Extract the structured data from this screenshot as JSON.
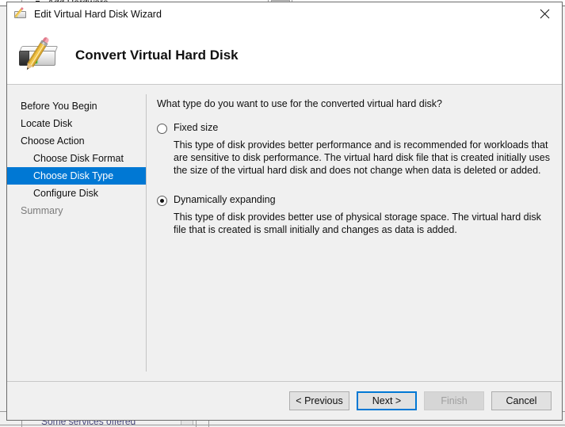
{
  "background": {
    "top_window_text": "Add Hardware",
    "bottom_window_text": "Some services offered"
  },
  "dialog": {
    "titlebar": {
      "title": "Edit Virtual Hard Disk Wizard",
      "icon": "disk-pencil-icon",
      "close_label": "Close"
    },
    "header": {
      "heading": "Convert Virtual Hard Disk",
      "icon": "virtual-hard-disk-edit-icon"
    },
    "nav": {
      "items": [
        {
          "label": "Before You Begin",
          "indent": false,
          "selected": false,
          "dim": false
        },
        {
          "label": "Locate Disk",
          "indent": false,
          "selected": false,
          "dim": false
        },
        {
          "label": "Choose Action",
          "indent": false,
          "selected": false,
          "dim": false
        },
        {
          "label": "Choose Disk Format",
          "indent": true,
          "selected": false,
          "dim": false
        },
        {
          "label": "Choose Disk Type",
          "indent": true,
          "selected": true,
          "dim": false
        },
        {
          "label": "Configure Disk",
          "indent": true,
          "selected": false,
          "dim": false
        },
        {
          "label": "Summary",
          "indent": false,
          "selected": false,
          "dim": true
        }
      ],
      "selected_color": "#0078d4"
    },
    "content": {
      "question": "What type do you want to use for the converted virtual hard disk?",
      "options": [
        {
          "label": "Fixed size",
          "checked": false,
          "description": "This type of disk provides better performance and is recommended for workloads that are sensitive to disk performance. The virtual hard disk file that is created initially uses the size of the virtual hard disk and does not change when data is deleted or added."
        },
        {
          "label": "Dynamically expanding",
          "checked": true,
          "description": "This type of disk provides better use of physical storage space. The virtual hard disk file that is created is small initially and changes as data is added."
        }
      ]
    },
    "footer": {
      "buttons": [
        {
          "label": "< Previous",
          "state": "normal"
        },
        {
          "label": "Next >",
          "state": "default"
        },
        {
          "label": "Finish",
          "state": "disabled"
        },
        {
          "label": "Cancel",
          "state": "normal"
        }
      ]
    }
  }
}
